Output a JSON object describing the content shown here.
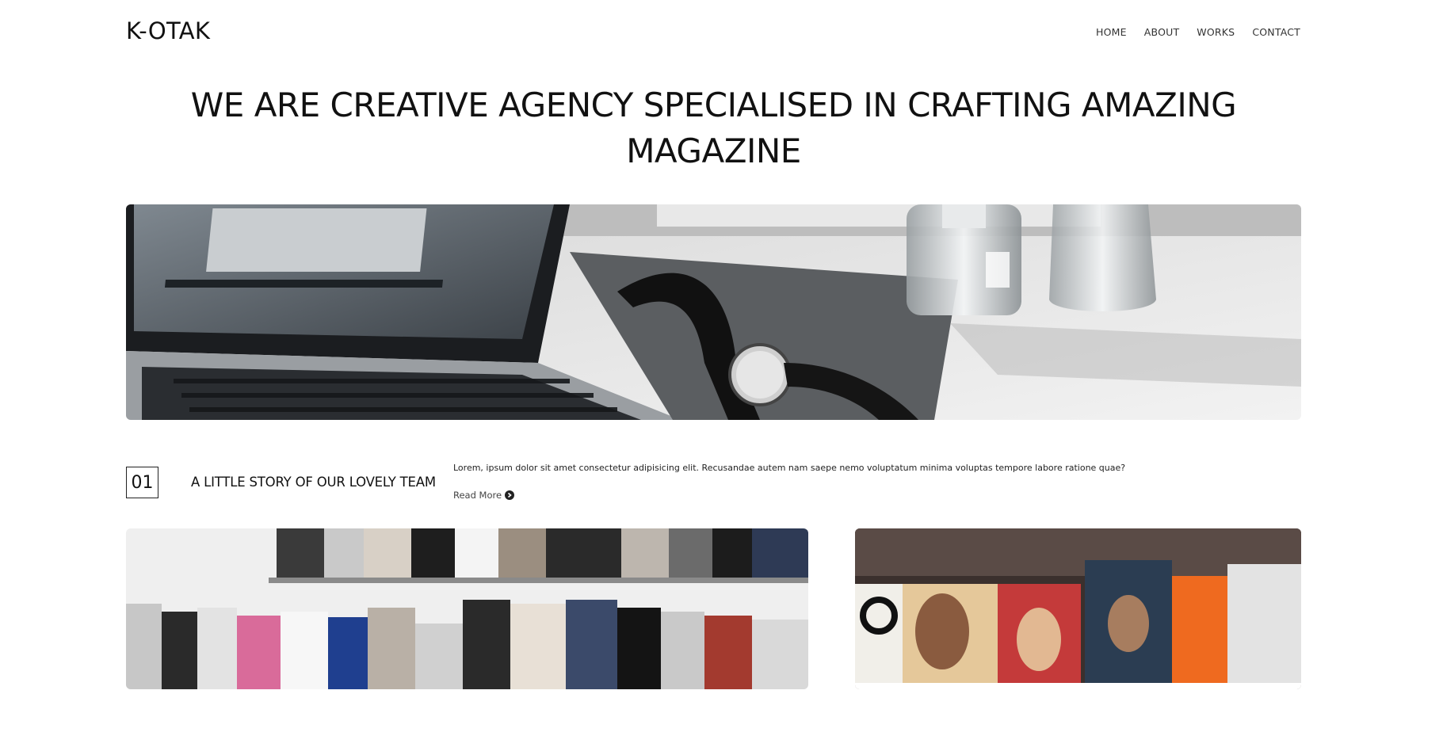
{
  "header": {
    "logo": "K-OTAK",
    "nav": [
      "HOME",
      "ABOUT",
      "WORKS",
      "CONTACT"
    ]
  },
  "hero": {
    "title": "WE ARE CREATIVE AGENCY SPECIALISED IN CRAFTING AMAZING MAGAZINE",
    "image_alt": "laptop-watch-perfume-desk"
  },
  "story": {
    "number": "01",
    "title": "A LITTLE STORY OF OUR LOVELY TEAM",
    "text": "Lorem, ipsum dolor sit amet consectetur adipisicing elit. Recusandae autem nam saepe nemo voluptatum minima voluptas tempore labore ratione quae?",
    "read_more": "Read More",
    "read_more_icon": "chevron-circle-right-icon"
  },
  "gallery": {
    "left_alt": "magazine-rack",
    "right_alt": "soccer-magazines"
  }
}
